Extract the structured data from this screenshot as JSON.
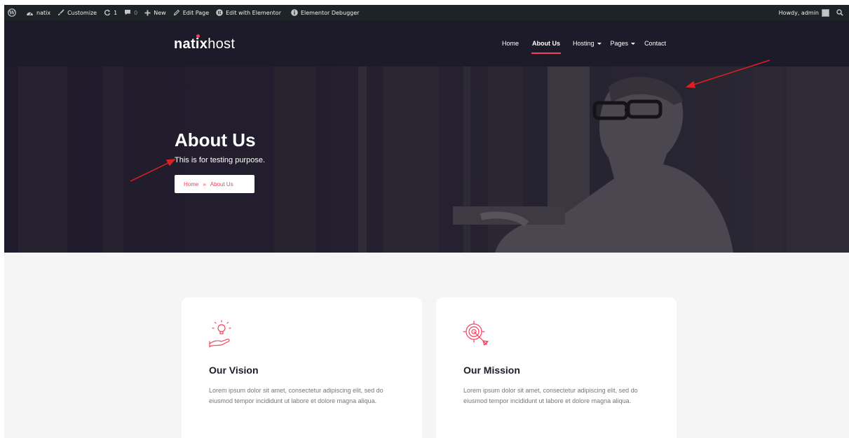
{
  "adminbar": {
    "site": "natix",
    "customize": "Customize",
    "updates_count": "1",
    "comments_count": "0",
    "new": "New",
    "edit_page": "Edit Page",
    "edit_elementor": "Edit with Elementor",
    "debugger": "Elementor Debugger",
    "howdy": "Howdy, admin"
  },
  "header": {
    "logo_bold": "natix",
    "logo_light": "host",
    "nav": [
      "Home",
      "About Us",
      "Hosting",
      "Pages",
      "Contact"
    ],
    "active": "About Us"
  },
  "hero": {
    "title": "About Us",
    "subtitle": "This is for testing purpose.",
    "breadcrumb_home": "Home",
    "breadcrumb_sep": "»",
    "breadcrumb_current": "About Us"
  },
  "cards": [
    {
      "title": "Our Vision",
      "icon": "lightbulb-hand-icon",
      "text": "Lorem ipsum dolor sit amet, consectetur adipiscing elit, sed do eiusmod tempor incididunt ut labore et dolore magna aliqua."
    },
    {
      "title": "Our Mission",
      "icon": "target-arrow-icon",
      "text": "Lorem ipsum dolor sit amet, consectetur adipiscing elit, sed do eiusmod tempor incididunt ut labore et dolore magna aliqua."
    }
  ],
  "colors": {
    "accent": "#f3405e",
    "dark": "#1d1a29",
    "adminbar": "#1e2327",
    "annotation": "#e0201f"
  }
}
